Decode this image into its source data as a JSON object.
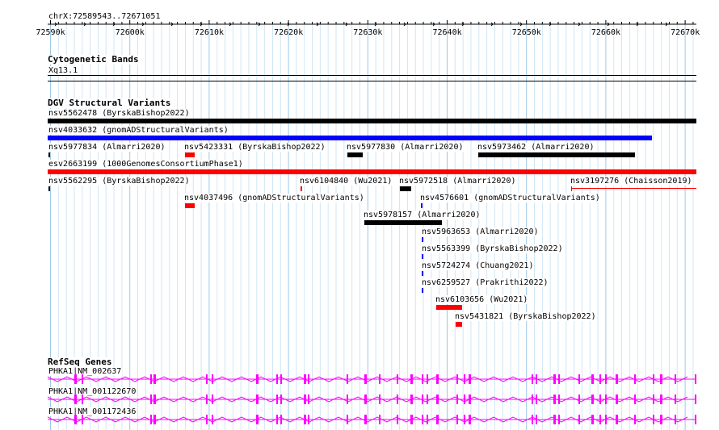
{
  "location": "chrX:72589543..72671051",
  "ruler": {
    "ticks": [
      "72590k",
      "72600k",
      "72610k",
      "72620k",
      "72630k",
      "72640k",
      "72650k",
      "72660k",
      "72670k"
    ]
  },
  "cytoband_track": {
    "title": "Cytogenetic Bands",
    "band": "Xq13.1"
  },
  "dgv_track": {
    "title": "DGV Structural Variants",
    "variants": [
      {
        "label": "nsv5562478 (ByrskaBishop2022)",
        "color": "#000000"
      },
      {
        "label": "nsv4033632 (gnomADStructuralVariants)",
        "color": "#0000ff"
      },
      {
        "label": "nsv5977834 (Almarri2020)",
        "color": "#000000"
      },
      {
        "label": "nsv5423331 (ByrskaBishop2022)",
        "color": "#ff0000"
      },
      {
        "label": "nsv5977830 (Almarri2020)",
        "color": "#000000"
      },
      {
        "label": "nsv5973462 (Almarri2020)",
        "color": "#000000"
      },
      {
        "label": "esv2663199 (1000GenomesConsortiumPhase1)",
        "color": "#ff0000"
      },
      {
        "label": "nsv5562295 (ByrskaBishop2022)",
        "color": "#000000"
      },
      {
        "label": "nsv6104840 (Wu2021)",
        "color": "#ff0000"
      },
      {
        "label": "nsv5972518 (Almarri2020)",
        "color": "#000000"
      },
      {
        "label": "nsv3197276 (Chaisson2019)",
        "color": "#ff0000"
      },
      {
        "label": "nsv4037496 (gnomADStructuralVariants)",
        "color": "#ff0000"
      },
      {
        "label": "nsv4576601 (gnomADStructuralVariants)",
        "color": "#0000ff"
      },
      {
        "label": "nsv5978157 (Almarri2020)",
        "color": "#000000"
      },
      {
        "label": "nsv5963653 (Almarri2020)",
        "color": "#0000ff"
      },
      {
        "label": "nsv5563399 (ByrskaBishop2022)",
        "color": "#0000ff"
      },
      {
        "label": "nsv5724274 (Chuang2021)",
        "color": "#0000ff"
      },
      {
        "label": "nsv6259527 (Prakrithi2022)",
        "color": "#0000ff"
      },
      {
        "label": "nsv6103656 (Wu2021)",
        "color": "#ff0000"
      },
      {
        "label": "nsv5431821 (ByrskaBishop2022)",
        "color": "#ff0000"
      }
    ]
  },
  "refseq_track": {
    "title": "RefSeq Genes",
    "gene_color": "#ff00ff",
    "transcripts": [
      {
        "label": "PHKA1|NM_002637"
      },
      {
        "label": "PHKA1|NM_001122670"
      },
      {
        "label": "PHKA1|NM_001172436"
      }
    ]
  }
}
